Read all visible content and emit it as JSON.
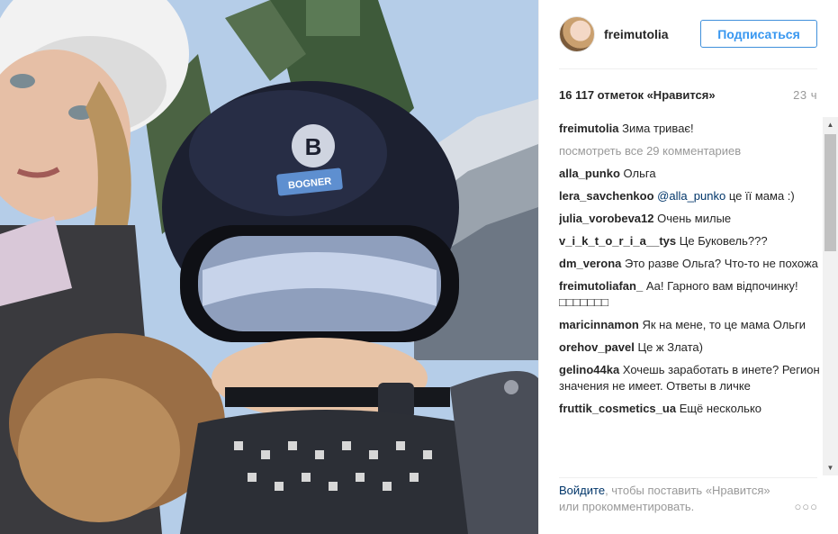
{
  "post": {
    "username": "freimutolia",
    "follow_label": "Подписаться",
    "likes": "16 117 отметок «Нравится»",
    "time": "23 ч"
  },
  "comments": [
    {
      "user": "freimutolia",
      "text": "Зима триває!"
    },
    {
      "user": "alla_punko",
      "text": "Ольга"
    },
    {
      "user": "lera_savchenkoo",
      "mention": "@alla_punko",
      "text": "це її мама :)"
    },
    {
      "user": "julia_vorobeva12",
      "text": "Очень милые"
    },
    {
      "user": "v_i_k_t_o_r_i_a__tys",
      "text": "Це Буковель???"
    },
    {
      "user": "dm_verona",
      "text": "Это разве Ольга? Что-то не похожа"
    },
    {
      "user": "freimutoliafan_",
      "text": "Аа! Гарного вам відпочинку! □□□□□□□"
    },
    {
      "user": "maricinnamon",
      "text": "Як на мене, то це мама Ольги"
    },
    {
      "user": "orehov_pavel",
      "text": "Це ж Злата)"
    },
    {
      "user": "gelino44ka",
      "text": "Хочешь заработать в инете? Регион значения не имеет. Ответы в личке"
    },
    {
      "user": "fruttik_cosmetics_ua",
      "text": "Ещё несколько"
    }
  ],
  "view_all": "посмотреть все 29 комментариев",
  "footer": {
    "login_link": "Войдите",
    "text": ", чтобы поставить «Нравится» или прокомментировать."
  },
  "photo": {
    "helmet_brand": "B",
    "goggle_brand": "BOGNER"
  },
  "icons": {
    "more": "more-options-icon",
    "scroll_up": "scroll-up-icon",
    "scroll_down": "scroll-down-icon"
  }
}
